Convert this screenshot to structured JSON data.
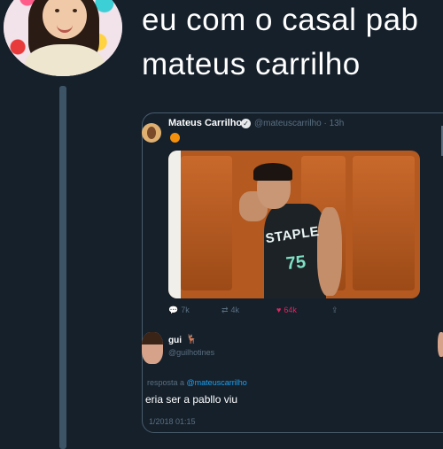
{
  "tweet": {
    "text_line1": "eu com o casal pab",
    "text_line2": "mateus carrilho"
  },
  "quoted": {
    "author_name": "Mateus Carrilho",
    "verified_mark": "✓",
    "author_handle": "@mateuscarrilho · 13h",
    "photo_shirt_text": "STAPLE",
    "photo_shirt_number": "75",
    "actions": {
      "reply_count": "7k",
      "retweet_count": "4k",
      "like_count": "64k"
    }
  },
  "reply": {
    "name": "gui",
    "emoji": "🦌",
    "handle": "@guilhotines",
    "replying_to_prefix": "resposta a",
    "replying_to_mention": "@mateuscarrilho",
    "text": "eria ser a pabllo viu",
    "timestamp": "1/2018 01:15"
  },
  "colors": {
    "background": "#15202b",
    "thread_line": "#3d5466",
    "secondary_text": "#5b6f80",
    "link": "#1da1f2",
    "like": "#e0245e"
  }
}
